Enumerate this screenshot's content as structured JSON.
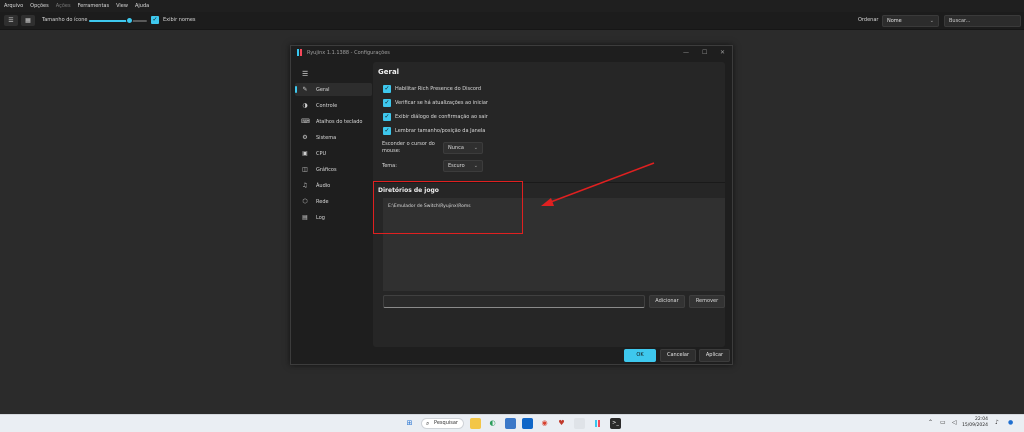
{
  "menu": [
    "Arquivo",
    "Opções",
    "Ações",
    "Ferramentas",
    "View",
    "Ajuda"
  ],
  "menu_disabled_index": 2,
  "toolbar": {
    "icon_size_label": "Tamanho do ícone",
    "icon_size_value": 0.7,
    "show_names_label": "Exibir nomes",
    "show_names_checked": true,
    "order_label": "Ordenar",
    "order_value": "Nome",
    "search_placeholder": "Buscar..."
  },
  "dialog": {
    "title": "Ryujinx 1.1.1388 - Configurações",
    "nav": [
      {
        "label": "Geral",
        "icon": "wrench-icon",
        "active": true
      },
      {
        "label": "Controle",
        "icon": "gamepad-icon"
      },
      {
        "label": "Atalhos do teclado",
        "icon": "keyboard-icon"
      },
      {
        "label": "Sistema",
        "icon": "gear-icon"
      },
      {
        "label": "CPU",
        "icon": "cpu-icon"
      },
      {
        "label": "Gráficos",
        "icon": "graphics-icon"
      },
      {
        "label": "Áudio",
        "icon": "music-note-icon"
      },
      {
        "label": "Rede",
        "icon": "network-icon"
      },
      {
        "label": "Log",
        "icon": "document-icon"
      }
    ],
    "general": {
      "heading": "Geral",
      "checkboxes": [
        {
          "label": "Habilitar Rich Presence do Discord",
          "checked": true
        },
        {
          "label": "Verificar se há atualizações ao iniciar",
          "checked": true
        },
        {
          "label": "Exibir diálogo de confirmação ao sair",
          "checked": true
        },
        {
          "label": "Lembrar tamanho/posição da Janela",
          "checked": true
        }
      ],
      "hide_cursor_label": "Esconder o cursor do mouse:",
      "hide_cursor_value": "Nunca",
      "theme_label": "Tema:",
      "theme_value": "Escuro"
    },
    "game_dirs": {
      "heading": "Diretórios de jogo",
      "entries": [
        "E:\\Emulador de Switch\\Ryujinx\\Roms"
      ],
      "add_label": "Adicionar",
      "remove_label": "Remover"
    },
    "footer": {
      "ok": "OK",
      "cancel": "Cancelar",
      "apply": "Aplicar"
    }
  },
  "taskbar": {
    "search_label": "Pesquisar",
    "time": "22:04",
    "date": "15/09/2024"
  },
  "colors": {
    "accent": "#3ec8ee",
    "annotation": "#e02020",
    "logo_left": "#36c7f0",
    "logo_right": "#f5485a"
  }
}
